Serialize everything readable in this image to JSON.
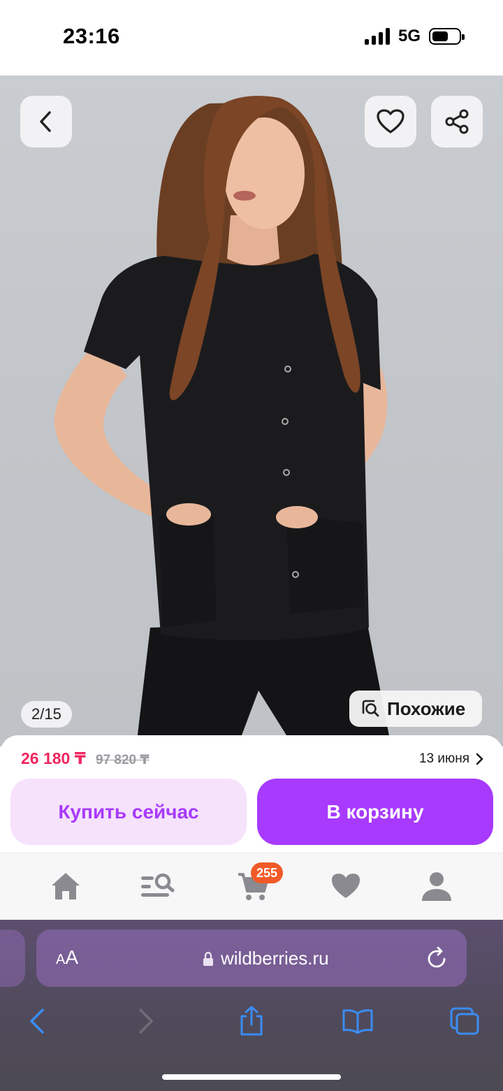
{
  "status_bar": {
    "time": "23:16",
    "network": "5G"
  },
  "hero": {
    "counter": "2/15",
    "similar_label": "Похожие"
  },
  "product": {
    "price": "26 180 ₸",
    "old_price": "97 820 ₸",
    "delivery_date": "13 июня",
    "buy_now_label": "Купить сейчас",
    "add_to_cart_label": "В корзину"
  },
  "app_nav": {
    "cart_count": "255",
    "items": [
      "home-icon",
      "catalog-search-icon",
      "cart-icon",
      "favorites-icon",
      "profile-icon"
    ]
  },
  "browser": {
    "text_size_label": "AA",
    "url": "wildberries.ru"
  },
  "colors": {
    "accent": "#a73afd",
    "accent_light": "#f6e2fb",
    "price": "#f0265f",
    "badge": "#f05a28"
  }
}
